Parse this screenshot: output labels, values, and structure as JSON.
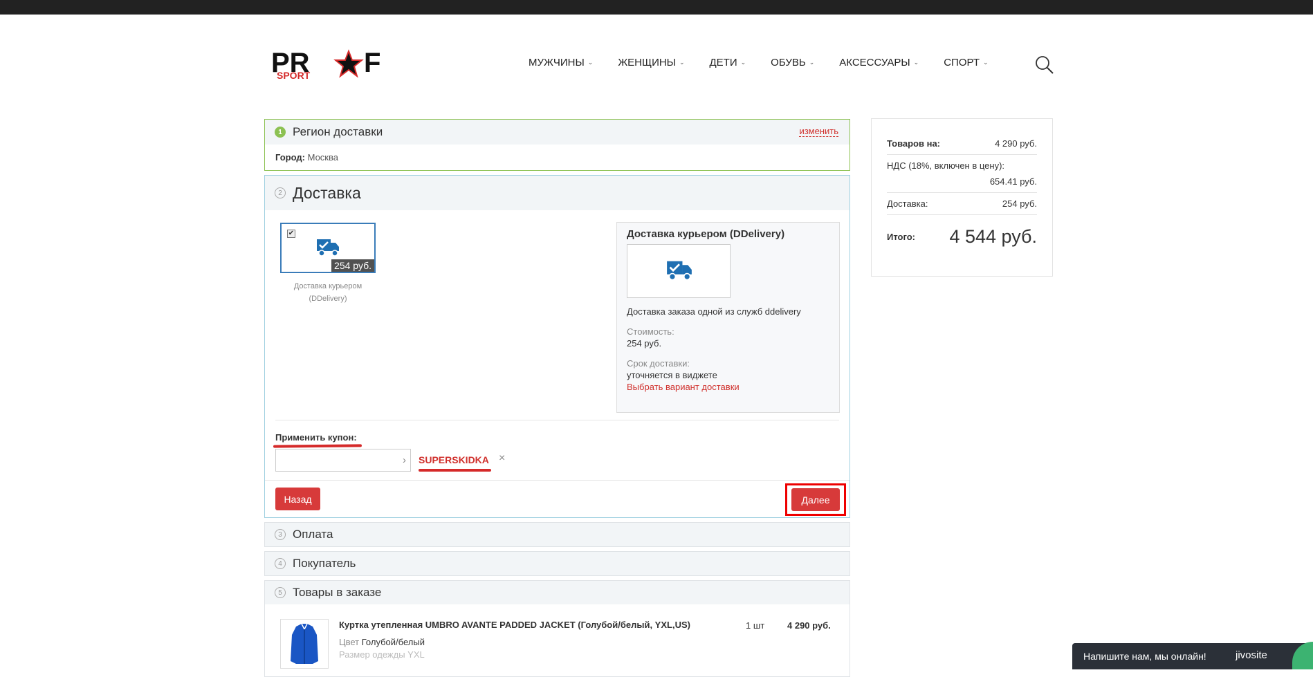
{
  "header": {
    "logo_text": "PROF SPORT",
    "nav": [
      {
        "label": "МУЖЧИНЫ"
      },
      {
        "label": "ЖЕНЩИНЫ"
      },
      {
        "label": "ДЕТИ"
      },
      {
        "label": "ОБУВЬ"
      },
      {
        "label": "АКСЕССУАРЫ"
      },
      {
        "label": "СПОРТ"
      }
    ]
  },
  "region": {
    "step": "1",
    "title": "Регион доставки",
    "change_link": "изменить",
    "city_label": "Город:",
    "city_value": "Москва"
  },
  "delivery": {
    "step": "2",
    "title": "Доставка",
    "option": {
      "price": "254 руб.",
      "name": "Доставка курьером (DDelivery)",
      "checked": true
    },
    "detail": {
      "title": "Доставка курьером (DDelivery)",
      "description": "Доставка заказа одной из служб ddelivery",
      "cost_label": "Стоимость:",
      "cost_value": "254 руб.",
      "time_label": "Срок доставки:",
      "time_value": "уточняется в виджете",
      "choose_link": "Выбрать вариант доставки"
    },
    "coupon": {
      "label": "Применить купон:",
      "input_value": "",
      "applied_code": "SUPERSKIDKA",
      "remove_icon": "×"
    },
    "back_button": "Назад",
    "next_button": "Далее"
  },
  "payment": {
    "step": "3",
    "title": "Оплата"
  },
  "buyer": {
    "step": "4",
    "title": "Покупатель"
  },
  "items": {
    "step": "5",
    "title": "Товары в заказе",
    "products": [
      {
        "title": "Куртка утепленная UMBRO AVANTE PADDED JACKET (Голубой/белый, YXL,US)",
        "qty": "1 шт",
        "price": "4 290 руб.",
        "color_label": "Цвет",
        "color_value": "Голубой/белый",
        "size_text": "Размер одежды YXL"
      }
    ]
  },
  "summary": {
    "goods_label": "Товаров на:",
    "goods_value": "4 290 руб.",
    "vat_label": "НДС (18%, включен в цену):",
    "vat_value": "654.41 руб.",
    "delivery_label": "Доставка:",
    "delivery_value": "254 руб.",
    "total_label": "Итого:",
    "total_value": "4 544 руб."
  },
  "chat": {
    "text": "Напишите нам, мы онлайн!",
    "brand": "jivosite"
  },
  "colors": {
    "accent_red": "#d73a3a",
    "region_green": "#8cc152",
    "icon_blue": "#1f6fb2"
  }
}
